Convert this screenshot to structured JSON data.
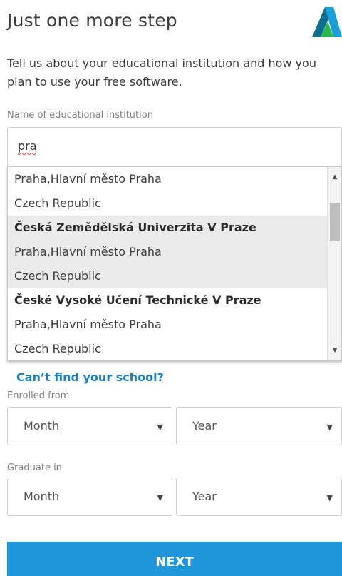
{
  "header": {
    "title": "Just one more step",
    "logo_icon": "autodesk-logo-icon"
  },
  "intro_text": "Tell us about your educational institution and how you plan to use your free software.",
  "institution": {
    "label": "Name of educational institution",
    "value": "pra"
  },
  "suggestions": {
    "partial_first": {
      "region": "Praha,Hlavní město Praha",
      "country": "Czech Republic"
    },
    "items": [
      {
        "name": "Česká Zemědělská Univerzita V Praze",
        "region": "Praha,Hlavní město Praha",
        "country": "Czech Republic",
        "highlighted": true
      },
      {
        "name": "České Vysoké Učení Technické V Praze",
        "region": "Praha,Hlavní město Praha",
        "country": "Czech Republic",
        "highlighted": false
      }
    ]
  },
  "cant_find_link": "Can’t find your school?",
  "enrolled": {
    "label": "Enrolled from",
    "month": "Month",
    "year": "Year"
  },
  "graduate": {
    "label": "Graduate in",
    "month": "Month",
    "year": "Year"
  },
  "next_button": "NEXT",
  "colors": {
    "accent": "#1e96d9",
    "link": "#1b7fc4",
    "highlight": "#ebebeb"
  }
}
